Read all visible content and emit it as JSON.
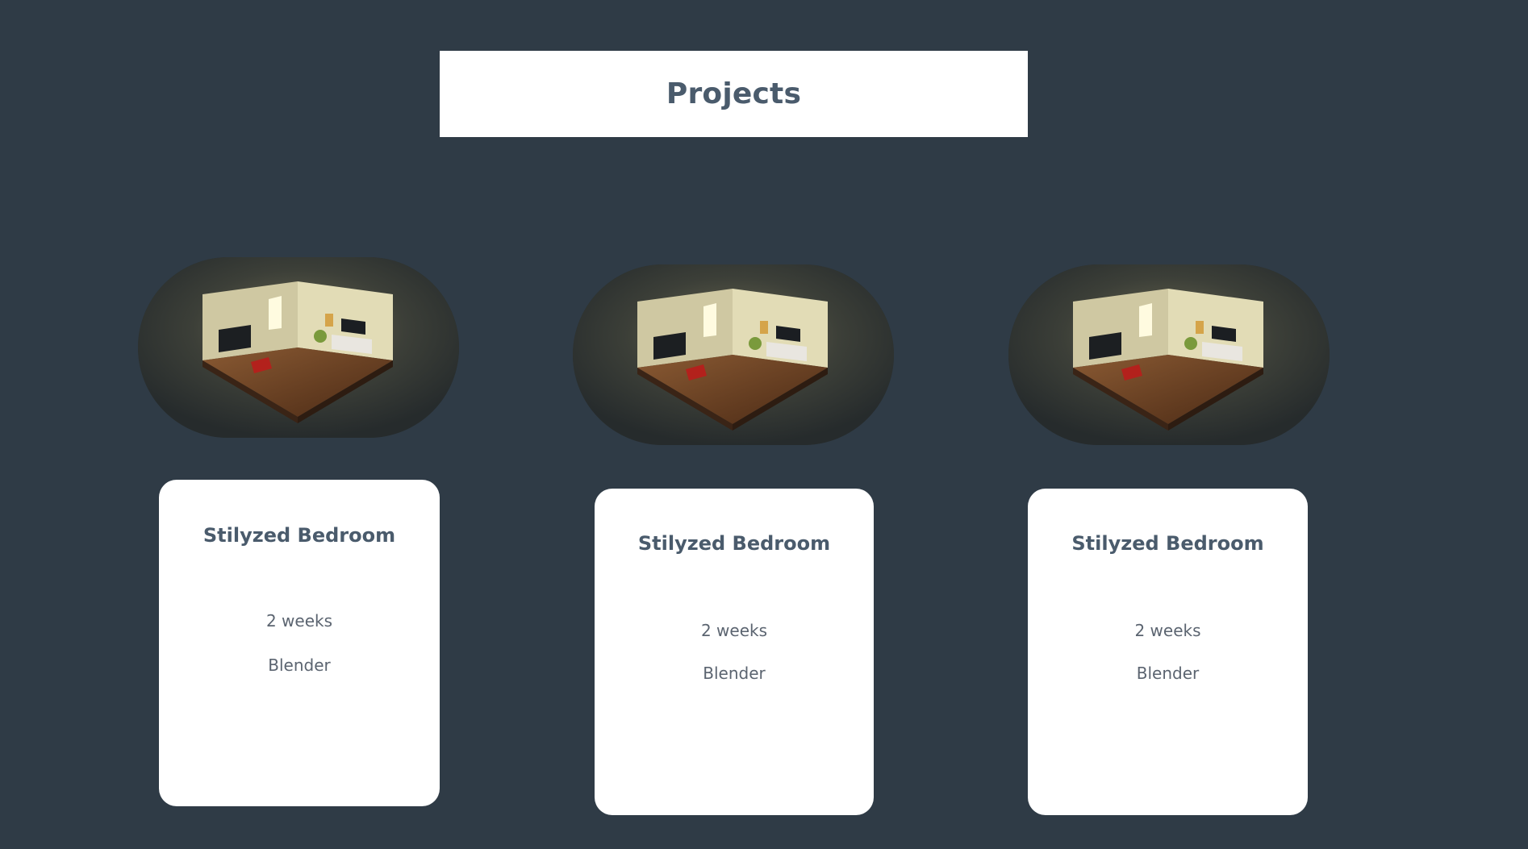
{
  "header": {
    "title": "Projects"
  },
  "projects": [
    {
      "image": "isometric-bedroom-render",
      "title": "Stilyzed Bedroom",
      "duration": "2 weeks",
      "tool": "Blender"
    },
    {
      "image": "isometric-bedroom-render",
      "title": "Stilyzed Bedroom",
      "duration": "2 weeks",
      "tool": "Blender"
    },
    {
      "image": "isometric-bedroom-render",
      "title": "Stilyzed Bedroom",
      "duration": "2 weeks",
      "tool": "Blender"
    }
  ],
  "colors": {
    "background": "#2f3b46",
    "card": "#ffffff",
    "heading_text": "#4a5b6c",
    "body_text": "#5b6470"
  }
}
